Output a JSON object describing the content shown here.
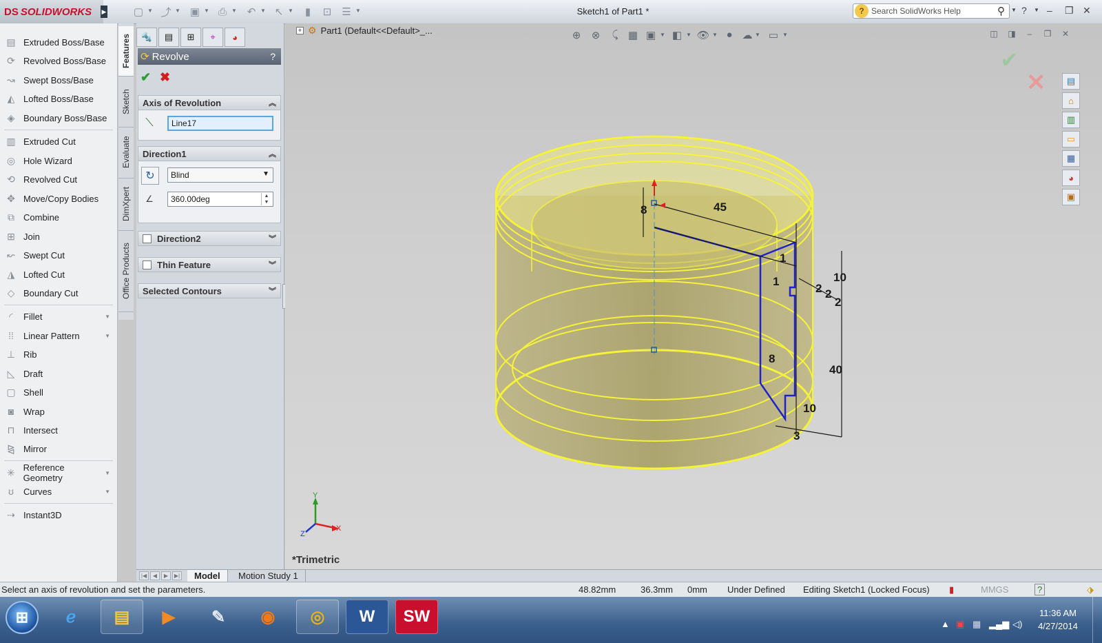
{
  "app": {
    "brand_prefix": "DS",
    "brand": "SOLIDWORKS",
    "doc_title": "Sketch1 of Part1 *",
    "search_placeholder": "Search SolidWorks Help"
  },
  "command_manager": {
    "items": [
      {
        "label": "Extruded Boss/Base",
        "icon": "extrude-boss-icon"
      },
      {
        "label": "Revolved Boss/Base",
        "icon": "revolve-boss-icon"
      },
      {
        "label": "Swept Boss/Base",
        "icon": "swept-boss-icon"
      },
      {
        "label": "Lofted Boss/Base",
        "icon": "lofted-boss-icon"
      },
      {
        "label": "Boundary Boss/Base",
        "icon": "boundary-boss-icon"
      },
      {
        "label": "Extruded Cut",
        "icon": "extruded-cut-icon"
      },
      {
        "label": "Hole Wizard",
        "icon": "hole-wizard-icon"
      },
      {
        "label": "Revolved Cut",
        "icon": "revolved-cut-icon"
      },
      {
        "label": "Move/Copy Bodies",
        "icon": "move-copy-icon"
      },
      {
        "label": "Combine",
        "icon": "combine-icon"
      },
      {
        "label": "Join",
        "icon": "join-icon"
      },
      {
        "label": "Swept Cut",
        "icon": "swept-cut-icon"
      },
      {
        "label": "Lofted Cut",
        "icon": "lofted-cut-icon"
      },
      {
        "label": "Boundary Cut",
        "icon": "boundary-cut-icon"
      },
      {
        "label": "Fillet",
        "icon": "fillet-icon"
      },
      {
        "label": "Linear Pattern",
        "icon": "linear-pattern-icon"
      },
      {
        "label": "Rib",
        "icon": "rib-icon"
      },
      {
        "label": "Draft",
        "icon": "draft-icon"
      },
      {
        "label": "Shell",
        "icon": "shell-icon"
      },
      {
        "label": "Wrap",
        "icon": "wrap-icon"
      },
      {
        "label": "Intersect",
        "icon": "intersect-icon"
      },
      {
        "label": "Mirror",
        "icon": "mirror-icon"
      },
      {
        "label": "Reference Geometry",
        "icon": "reference-geometry-icon"
      },
      {
        "label": "Curves",
        "icon": "curves-icon"
      },
      {
        "label": "Instant3D",
        "icon": "instant3d-icon"
      }
    ]
  },
  "vertical_tabs": [
    "Features",
    "Sketch",
    "Evaluate",
    "DimXpert",
    "Office Products"
  ],
  "property_manager": {
    "title": "Revolve",
    "help": "?",
    "axis_section": "Axis of Revolution",
    "axis_value": "Line17",
    "direction1_section": "Direction1",
    "direction_type": "Blind",
    "angle_value": "360.00deg",
    "direction2_section": "Direction2",
    "thin_feature_section": "Thin Feature",
    "selected_contours_section": "Selected Contours"
  },
  "graphics": {
    "tree_label": "Part1  (Default<<Default>_...",
    "view_orientation": "*Trimetric",
    "dimensions": [
      "8",
      "45",
      "1",
      "1",
      "10",
      "2",
      "2",
      "2",
      "8",
      "40",
      "10",
      "3"
    ],
    "triad": {
      "x": "X",
      "y": "Y",
      "z": "Z"
    },
    "colors": {
      "body": "#b8ad6a",
      "highlight": "#f5f23a",
      "sketch": "#1e22c8",
      "dim": "#1a1a1a"
    }
  },
  "bottom_tabs": [
    "Model",
    "Motion Study 1"
  ],
  "status_bar": {
    "message": "Select an axis of revolution and set the parameters.",
    "x": "48.82mm",
    "y": "36.3mm",
    "z": "0mm",
    "state": "Under Defined",
    "editing": "Editing Sketch1 (Locked Focus)",
    "units": "MMGS"
  },
  "taskbar": {
    "time": "11:36 AM",
    "date": "4/27/2014"
  }
}
